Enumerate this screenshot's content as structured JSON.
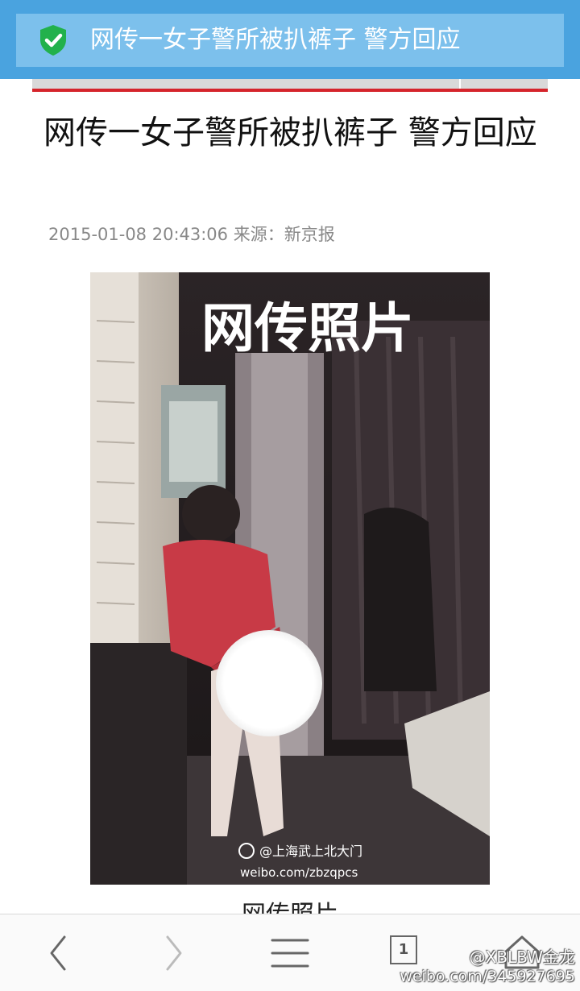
{
  "browser": {
    "page_title": "网传一女子警所被扒裤子 警方回应",
    "tab_count": "1"
  },
  "article": {
    "headline": "网传一女子警所被扒裤子 警方回应",
    "date": "2015-01-08 20:43:06",
    "source_label": "来源：",
    "source": "新京报",
    "photo_overlay_text": "网传照片",
    "photo_credit_handle": "@上海武上北大门",
    "photo_credit_url": "weibo.com/zbzqpcs",
    "caption": "网传照片"
  },
  "watermark": {
    "handle": "@XBLBW金龙",
    "url": "weibo.com/345927695"
  },
  "colors": {
    "toolbar": "#4aa3df",
    "url_box": "#7cc0ec",
    "shield": "#22b14c",
    "accent_line": "#d5242b"
  },
  "icons": {
    "security": "shield-check-icon",
    "back": "chevron-left-icon",
    "forward": "chevron-right-icon",
    "menu": "hamburger-menu-icon",
    "home": "home-icon"
  }
}
